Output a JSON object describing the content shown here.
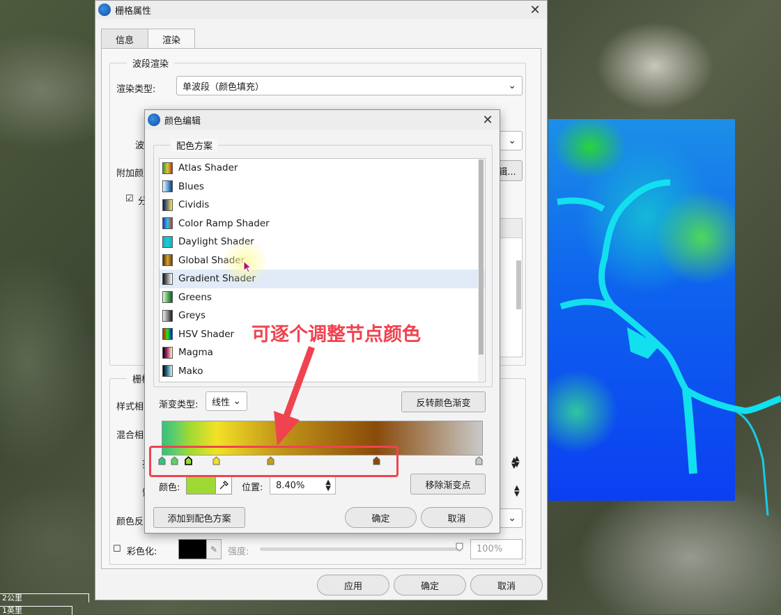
{
  "map": {
    "scale_top": "2公里",
    "scale_bottom": "1英里"
  },
  "main_dialog": {
    "title": "栅格属性",
    "tabs": [
      "信息",
      "渲染"
    ],
    "band_group_title": "波段渲染",
    "render_type_label": "渲染类型:",
    "render_type_value": "单波段（颜色填充）",
    "left_label_1": "波",
    "left_label_2": "附加颜",
    "left_label_3": "分",
    "section2_title": "栅格",
    "style_label": "样式相",
    "blend_label": "混合相",
    "label_a": "亮",
    "label_b": "饱",
    "color_label": "颜色反",
    "colorize_label": "彩色化:",
    "strength_label": "强度:",
    "strength_value": "100%",
    "btn_right": "辑...",
    "btn_apply": "应用",
    "btn_ok": "确定",
    "btn_cancel": "取消"
  },
  "color_dialog": {
    "title": "颜色编辑",
    "scheme_group": "配色方案",
    "schemes": [
      {
        "name": "Atlas Shader",
        "swatch": [
          "#2ca02c",
          "#e8c43a",
          "#b5331e"
        ]
      },
      {
        "name": "Blues",
        "swatch": [
          "#f4f9ff",
          "#6aa6d8",
          "#0b3a78"
        ]
      },
      {
        "name": "Cividis",
        "swatch": [
          "#00204d",
          "#7c7b78",
          "#ffe945"
        ]
      },
      {
        "name": "Color Ramp Shader",
        "swatch": [
          "#2b2bd8",
          "#27c8d8",
          "#e02a20"
        ]
      },
      {
        "name": "Daylight Shader",
        "swatch": [
          "#0fb4c8",
          "#21c9d6",
          "#0fb4c8"
        ]
      },
      {
        "name": "Global Shader",
        "swatch": [
          "#4a2c10",
          "#d8a52a",
          "#6f3d15"
        ]
      },
      {
        "name": "Gradient Shader",
        "swatch": [
          "#111111",
          "#888888",
          "#ffffff"
        ]
      },
      {
        "name": "Greens",
        "swatch": [
          "#e9f6e4",
          "#5cb561",
          "#0a5b25"
        ]
      },
      {
        "name": "Greys",
        "swatch": [
          "#f0f0f0",
          "#888888",
          "#1a1a1a"
        ]
      },
      {
        "name": "HSV Shader",
        "swatch": [
          "#ff0000",
          "#00ff00",
          "#0000ff"
        ]
      },
      {
        "name": "Magma",
        "swatch": [
          "#000004",
          "#b5367a",
          "#fcfdbf"
        ]
      },
      {
        "name": "Mako",
        "swatch": [
          "#0b0405",
          "#357ba3",
          "#def5e5"
        ]
      }
    ],
    "selected_scheme": "Gradient Shader",
    "gradient_type_label": "渐变类型:",
    "gradient_type_value": "线性",
    "reverse_btn": "反转颜色渐变",
    "color_label": "颜色:",
    "color_value": "#9fd933",
    "position_label": "位置:",
    "position_value": "8.40%",
    "remove_stop_btn": "移除渐变点",
    "add_to_scheme_btn": "添加到配色方案",
    "ok_btn": "确定",
    "cancel_btn": "取消",
    "stop_colors": [
      "#39c07a",
      "#5fcf6a",
      "#9fd933",
      "#f2e227",
      "#c89d1a",
      "#8a4a0a",
      "#c9c9c9"
    ]
  },
  "annotation": {
    "text": "可逐个调整节点颜色",
    "color": "#f0434f"
  }
}
